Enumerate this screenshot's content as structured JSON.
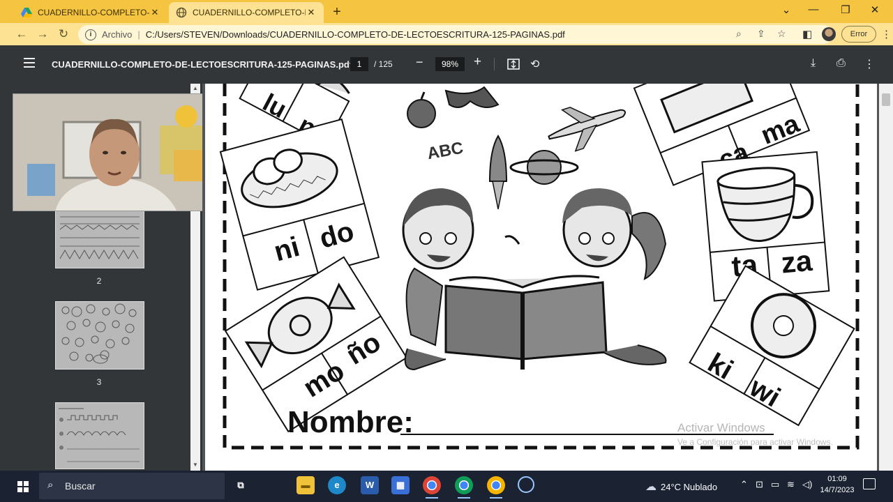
{
  "browser": {
    "tabs": [
      {
        "title": "CUADERNILLO-COMPLETO-DE-LE",
        "icon": "google-drive-icon",
        "active": false
      },
      {
        "title": "CUADERNILLO-COMPLETO-DE-LE",
        "icon": "globe-icon",
        "active": true
      }
    ],
    "new_tab": "+",
    "scheme_label": "Archivo",
    "url": "C:/Users/STEVEN/Downloads/CUADERNILLO-COMPLETO-DE-LECTOESCRITURA-125-PAGINAS.pdf",
    "error_label": "Error"
  },
  "pdf": {
    "title": "CUADERNILLO-COMPLETO-DE-LECTOESCRITURA-125-PAGINAS.pdf",
    "current_page": "1",
    "total_pages": "/ 125",
    "zoom": "98%",
    "thumbnails": [
      {
        "number": "2"
      },
      {
        "number": "3"
      },
      {
        "number": ""
      }
    ]
  },
  "worksheet": {
    "syllable_cards": [
      {
        "first": "lu",
        "second": "na"
      },
      {
        "first": "ni",
        "second": "do"
      },
      {
        "first": "mo",
        "second": "ño"
      },
      {
        "first": "ca",
        "second": "ma"
      },
      {
        "first": "ta",
        "second": "za"
      },
      {
        "first": "ki",
        "second": "wi"
      }
    ],
    "abc": "ABC",
    "name_label": "Nombre:"
  },
  "watermark": {
    "line1": "Activar Windows",
    "line2": "Ve a Configuración para activar Windows."
  },
  "taskbar": {
    "search_label": "Buscar",
    "weather": "24°C  Nublado",
    "time": "01:09",
    "date": "14/7/2023"
  },
  "colors": {
    "tab_strip": "#f5c542",
    "toolbar": "#fde293",
    "pdf_toolbar": "#323639",
    "taskbar": "#1b2333"
  }
}
